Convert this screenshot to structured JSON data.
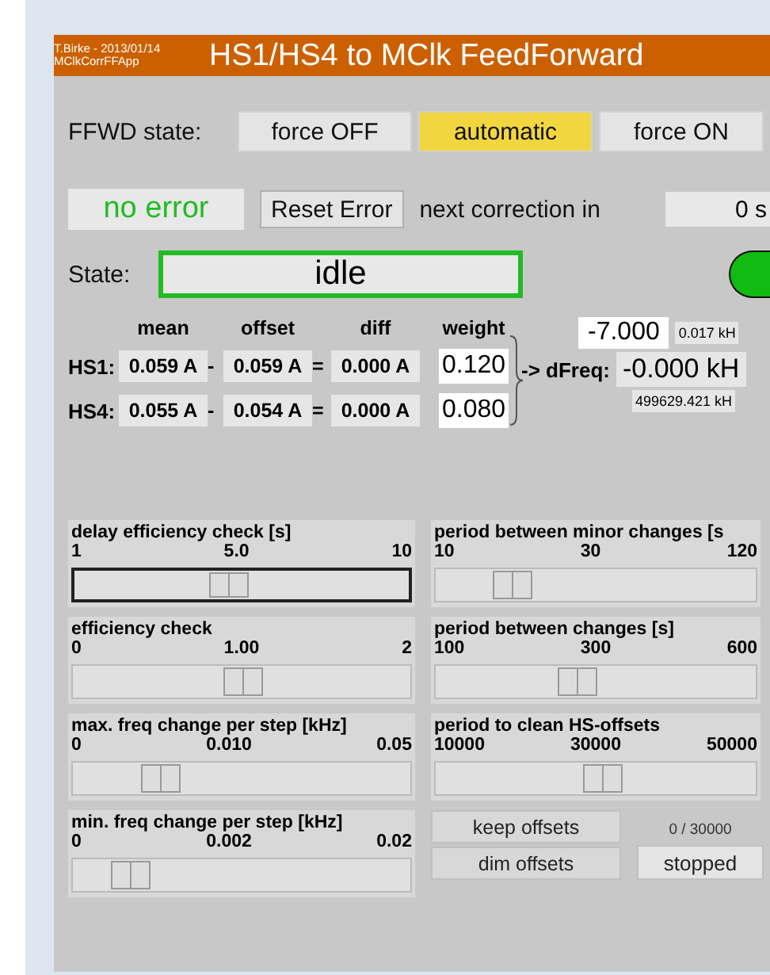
{
  "header": {
    "author": "T.Birke - 2013/01/14",
    "app": "MClkCorrFFApp",
    "title": "HS1/HS4 to MClk FeedForward"
  },
  "ffwd": {
    "label": "FFWD state:",
    "options": [
      {
        "label": "force OFF",
        "selected": false
      },
      {
        "label": "automatic",
        "selected": true
      },
      {
        "label": "force ON",
        "selected": false
      }
    ]
  },
  "error": {
    "status": "no error",
    "ok": true,
    "reset_button": "Reset Error",
    "next_label": "next correction in",
    "next_value": "0 s"
  },
  "state": {
    "label": "State:",
    "value": "idle",
    "ok": true,
    "indicator_on": true
  },
  "table": {
    "columns": [
      "mean",
      "offset",
      "diff",
      "weight"
    ],
    "rows": [
      {
        "name": "HS1:",
        "mean": "0.059 A",
        "minus": "-",
        "offset": "0.059 A",
        "equals": "=",
        "diff": "0.000 A",
        "weight": "0.120"
      },
      {
        "name": "HS4:",
        "mean": "0.055 A",
        "minus": "-",
        "offset": "0.054 A",
        "equals": "=",
        "diff": "0.000 A",
        "weight": "0.080"
      }
    ]
  },
  "dfreq": {
    "label": "-> dFreq:",
    "input": "-7.000",
    "step": "0.017 kH",
    "value": "-0.000 kH",
    "total": "499629.421 kH"
  },
  "sliders_left": [
    {
      "label": "delay efficiency check [s]",
      "min": "1",
      "mid": "5.0",
      "max": "10",
      "level": 0.46,
      "focused": true
    },
    {
      "label": "efficiency check",
      "min": "0",
      "mid": "1.00",
      "max": "2",
      "level": 0.5,
      "focused": false
    },
    {
      "label": "max. freq change per step [kHz]",
      "min": "0",
      "mid": "0.010",
      "max": "0.05",
      "level": 0.26,
      "focused": false
    },
    {
      "label": "min. freq change per step [kHz]",
      "min": "0",
      "mid": "0.002",
      "max": "0.02",
      "level": 0.17,
      "focused": false
    }
  ],
  "sliders_right": [
    {
      "label": "period between minor changes [s",
      "min": "10",
      "mid": "30",
      "max": "120",
      "level": 0.24,
      "focused": false
    },
    {
      "label": "period between changes [s]",
      "min": "100",
      "mid": "300",
      "max": "600",
      "level": 0.44,
      "focused": false
    },
    {
      "label": "period to clean HS-offsets",
      "min": "10000",
      "mid": "30000",
      "max": "50000",
      "level": 0.52,
      "focused": false
    }
  ],
  "offset_buttons": [
    "keep offsets",
    "dim offsets"
  ],
  "counter": "0 / 30000",
  "run_button": "stopped"
}
